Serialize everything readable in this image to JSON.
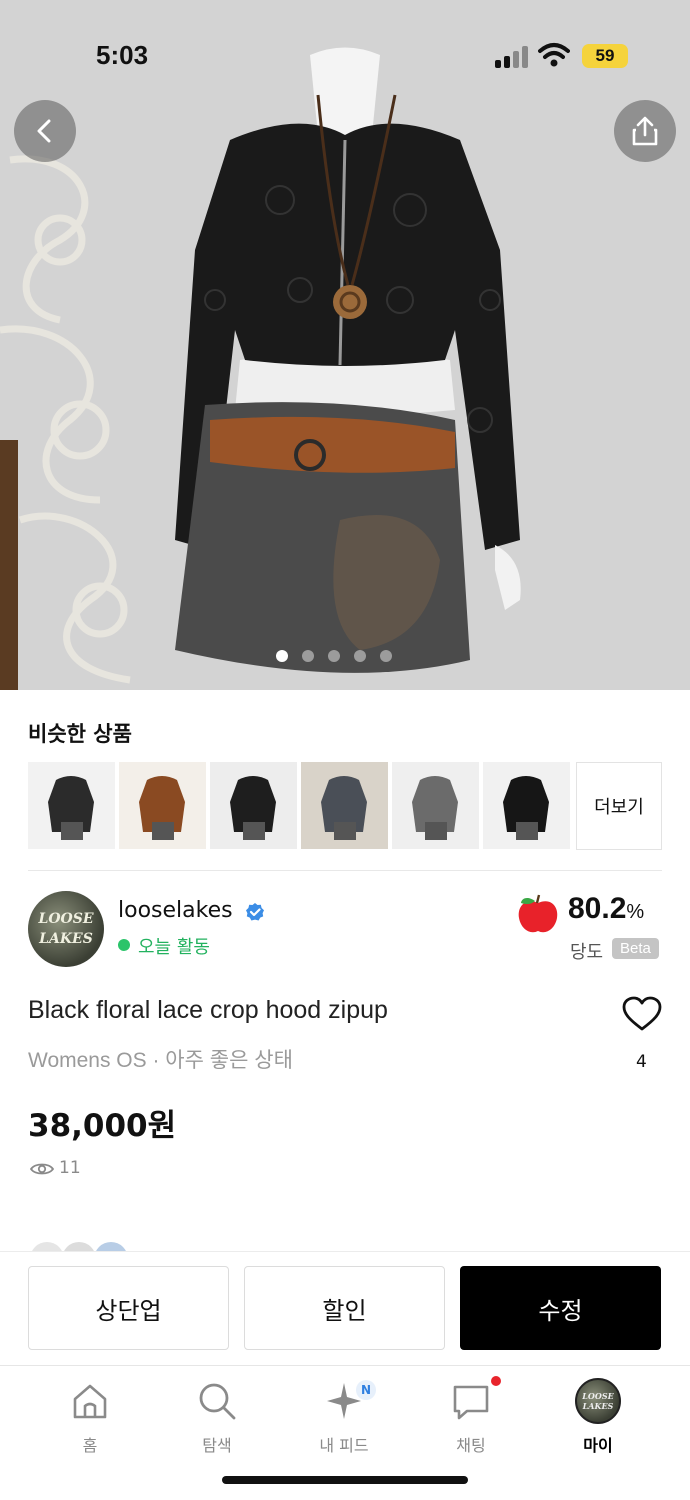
{
  "status_bar": {
    "time": "5:03",
    "battery": "59"
  },
  "similar": {
    "title": "비슷한 상품",
    "more_label": "더보기",
    "thumb_colors": [
      [
        "#f2f2f2",
        "#2b2b2b"
      ],
      [
        "#f3efe9",
        "#8a4a22"
      ],
      [
        "#ededed",
        "#1e1e1e"
      ],
      [
        "#d9d3c9",
        "#4a4f57"
      ],
      [
        "#efefef",
        "#6b6b6b"
      ],
      [
        "#f1f1f1",
        "#161616"
      ]
    ]
  },
  "seller": {
    "avatar_text": "LOOSE\nLAKES",
    "name": "looselakes",
    "activity": "오늘 활동",
    "score": "80.2",
    "score_unit": "%",
    "score_label": "당도",
    "beta": "Beta"
  },
  "product": {
    "title": "Black floral lace crop hood zipup",
    "meta": "Womens OS · 아주 좋은 상태",
    "price": "38,000원",
    "views": "11",
    "likes": "4"
  },
  "actions": {
    "bump": "상단업",
    "discount": "할인",
    "edit": "수정"
  },
  "tabs": [
    {
      "label": "홈"
    },
    {
      "label": "탐색"
    },
    {
      "label": "내 피드",
      "badge": "N"
    },
    {
      "label": "채팅"
    },
    {
      "label": "마이"
    }
  ],
  "colors": {
    "accent_green": "#23b25f",
    "verified_blue": "#3b8de6",
    "primary_button": "#000000"
  },
  "icons": [
    "back-icon",
    "share-icon",
    "verified-icon",
    "apple-icon",
    "heart-icon",
    "eye-icon",
    "home-icon",
    "search-icon",
    "sparkle-icon",
    "chat-icon"
  ]
}
